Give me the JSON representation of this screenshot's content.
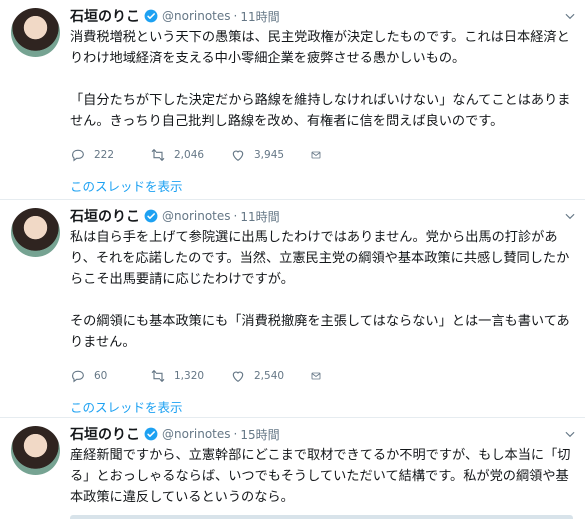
{
  "colors": {
    "accent": "#1da1f2",
    "muted": "#657786",
    "text": "#14171a",
    "divider": "#e6ecf0"
  },
  "tweets": [
    {
      "name": "石垣のりこ",
      "handle": "@norinotes",
      "time": "11時間",
      "paragraphs": [
        "消費税増税という天下の愚策は、民主党政権が決定したものです。これは日本経済とりわけ地域経済を支える中小零細企業を疲弊させる愚かしいもの。",
        "「自分たちが下した決定だから路線を維持しなければいけない」なんてことはありません。きっちり自己批判し路線を改め、有権者に信を問えば良いのです。"
      ],
      "replies": "222",
      "retweets": "2,046",
      "likes": "3,945",
      "thread_link": "このスレッドを表示"
    },
    {
      "name": "石垣のりこ",
      "handle": "@norinotes",
      "time": "11時間",
      "paragraphs": [
        "私は自ら手を上げて参院選に出馬したわけではありません。党から出馬の打診があり、それを応諾したのです。当然、立憲民主党の綱領や基本政策に共感し賛同したからこそ出馬要請に応じたわけですが。",
        "その綱領にも基本政策にも「消費税撤廃を主張してはならない」とは一言も書いてありません。"
      ],
      "replies": "60",
      "retweets": "1,320",
      "likes": "2,540",
      "thread_link": "このスレッドを表示"
    },
    {
      "name": "石垣のりこ",
      "handle": "@norinotes",
      "time": "15時間",
      "paragraphs": [
        "産経新聞ですから、立憲幹部にどこまで取材できてるか不明ですが、もし本当に「切る」とおっしゃるならば、いつでもそうしていただいて結構です。私が党の綱領や基本政策に違反しているというのなら。"
      ]
    }
  ],
  "icons": {
    "verified": "verified-badge-icon",
    "caret": "chevron-down-icon",
    "reply": "reply-icon",
    "retweet": "retweet-icon",
    "like": "heart-icon",
    "dm": "envelope-icon"
  }
}
